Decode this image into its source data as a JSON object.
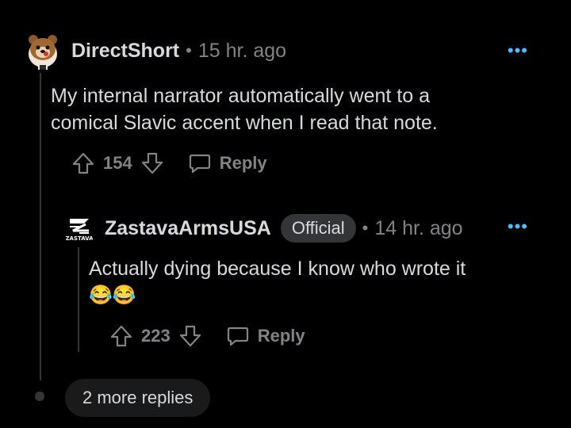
{
  "comments": [
    {
      "username": "DirectShort",
      "separator": "•",
      "time": "15 hr. ago",
      "more": "•••",
      "body_lines": [
        "My internal narrator automatically went to a",
        "comical Slavic accent when I read that note."
      ],
      "votes": "154",
      "reply_label": "Reply",
      "avatar_icon": "snoo-bear-avatar-icon"
    },
    {
      "username": "ZastavaArmsUSA",
      "badge": "Official",
      "separator": "•",
      "time": "14 hr. ago",
      "more": "•••",
      "body_lines": [
        "Actually dying because I know who wrote it"
      ],
      "emojis": "😂😂",
      "votes": "223",
      "reply_label": "Reply",
      "avatar_icon": "zastava-logo-icon",
      "avatar_text": "ZASTAVA"
    }
  ],
  "more_replies": "2 more replies",
  "colors": {
    "background": "#000000",
    "text": "#d7dadc",
    "muted": "#818384",
    "accent": "#4fbcff",
    "badge_bg": "#343536"
  }
}
